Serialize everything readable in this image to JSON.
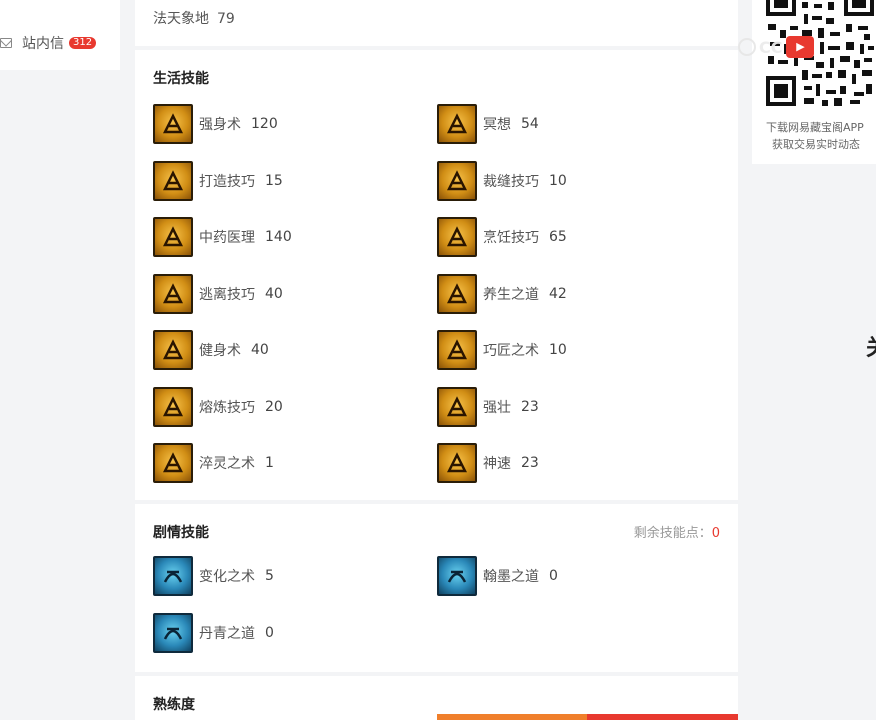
{
  "nav": {
    "message_label": "站内信",
    "message_count": "312"
  },
  "top_skill": {
    "name": "法天象地",
    "level": "79"
  },
  "life_skills": {
    "title": "生活技能",
    "items": [
      {
        "name": "强身术",
        "level": "120",
        "icon": "strength-icon"
      },
      {
        "name": "冥想",
        "level": "54",
        "icon": "meditation-icon"
      },
      {
        "name": "打造技巧",
        "level": "15",
        "icon": "forging-icon"
      },
      {
        "name": "裁缝技巧",
        "level": "10",
        "icon": "tailoring-icon"
      },
      {
        "name": "中药医理",
        "level": "140",
        "icon": "herb-medicine-icon"
      },
      {
        "name": "烹饪技巧",
        "level": "65",
        "icon": "cooking-icon"
      },
      {
        "name": "逃离技巧",
        "level": "40",
        "icon": "escape-icon"
      },
      {
        "name": "养生之道",
        "level": "42",
        "icon": "health-keeping-icon"
      },
      {
        "name": "健身术",
        "level": "40",
        "icon": "fitness-icon"
      },
      {
        "name": "巧匠之术",
        "level": "10",
        "icon": "craftsman-icon"
      },
      {
        "name": "熔炼技巧",
        "level": "20",
        "icon": "smelting-icon"
      },
      {
        "name": "强壮",
        "level": "23",
        "icon": "strong-icon"
      },
      {
        "name": "淬灵之术",
        "level": "1",
        "icon": "quench-spirit-icon"
      },
      {
        "name": "神速",
        "level": "23",
        "icon": "swift-icon"
      }
    ]
  },
  "plot_skills": {
    "title": "剧情技能",
    "remaining_label": "剩余技能点：",
    "remaining_value": "0",
    "items": [
      {
        "name": "变化之术",
        "level": "5",
        "icon": "transform-icon"
      },
      {
        "name": "翰墨之道",
        "level": "0",
        "icon": "calligraphy-icon"
      },
      {
        "name": "丹青之道",
        "level": "0",
        "icon": "painting-icon"
      }
    ]
  },
  "proficiency": {
    "title": "熟练度"
  },
  "qr_panel": {
    "caption_line1": "下载网易藏宝阁APP",
    "caption_line2": "获取交易实时动态"
  },
  "colors": {
    "accent_red": "#e8392f",
    "bar_orange": "#f07f2b",
    "icon_gold": "#d18e15",
    "icon_blue": "#2a88b8"
  }
}
